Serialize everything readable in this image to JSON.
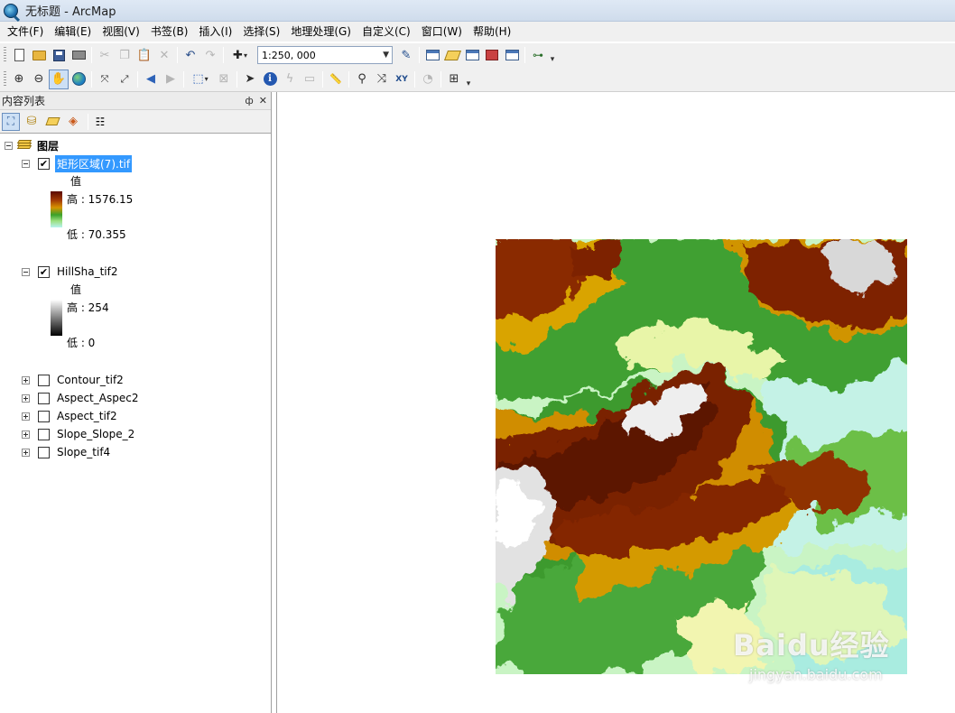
{
  "window": {
    "title": "无标题 - ArcMap"
  },
  "menu": [
    "文件(F)",
    "编辑(E)",
    "视图(V)",
    "书签(B)",
    "插入(I)",
    "选择(S)",
    "地理处理(G)",
    "自定义(C)",
    "窗口(W)",
    "帮助(H)"
  ],
  "toolbar": {
    "scale_value": "1:250, 000"
  },
  "toc": {
    "title": "内容列表",
    "pin_label": "ф",
    "close_label": "✕",
    "group": {
      "label": "图层"
    },
    "layers": [
      {
        "name": "矩形区域(7).tif",
        "checked": true,
        "selected": true,
        "expanded": true,
        "legend_field": "值",
        "high": "高 : 1576.15",
        "low": "低 : 70.355"
      },
      {
        "name": "HillSha_tif2",
        "checked": true,
        "selected": false,
        "expanded": true,
        "legend_field": "值",
        "high": "高 : 254",
        "low": "低 : 0"
      },
      {
        "name": "Contour_tif2",
        "checked": false,
        "expanded": false
      },
      {
        "name": "Aspect_Aspec2",
        "checked": false,
        "expanded": false
      },
      {
        "name": "Aspect_tif2",
        "checked": false,
        "expanded": false
      },
      {
        "name": "Slope_Slope_2",
        "checked": false,
        "expanded": false
      },
      {
        "name": "Slope_tif4",
        "checked": false,
        "expanded": false
      }
    ]
  },
  "watermark": {
    "brand": "Baidu经验",
    "url": "jingyan.baidu.com"
  },
  "colors": {
    "selection": "#3399ff",
    "dem_high": "#ffffff",
    "dem_mid": "#8b2a05",
    "dem_low": "#a8f0e0"
  }
}
